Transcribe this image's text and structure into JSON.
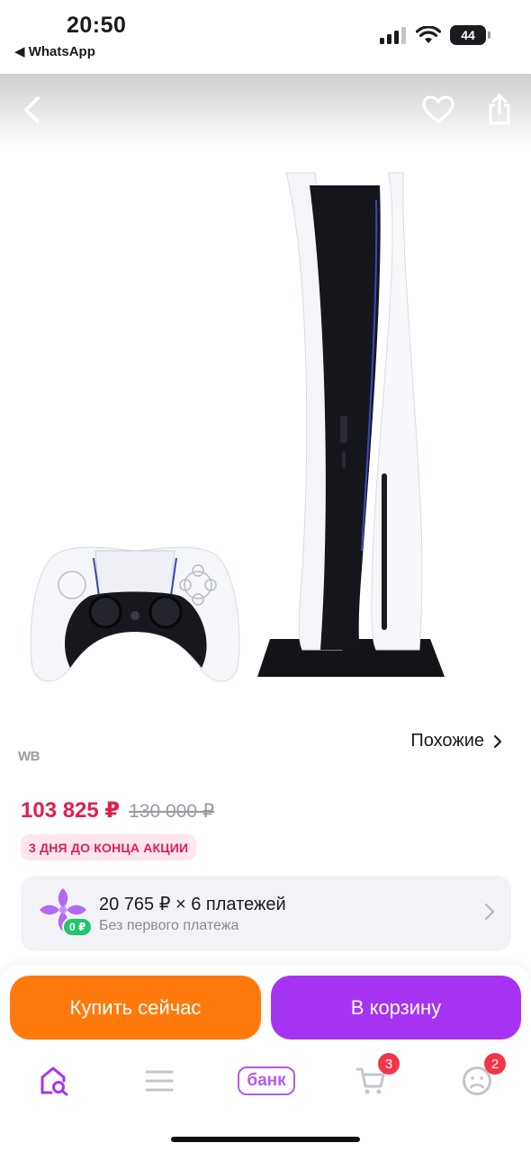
{
  "status_bar": {
    "time": "20:50",
    "back_app": "◀ WhatsApp",
    "battery": "44"
  },
  "header": {
    "back_icon": "chevron-left-icon",
    "favorite_icon": "heart-icon",
    "share_icon": "share-icon"
  },
  "product": {
    "image_subject": "console-and-controller",
    "similar_label": "Похожие",
    "brand_mark": "WB",
    "price_current": "103 825 ₽",
    "price_old": "130 000 ₽",
    "promo_badge": "3 ДНЯ ДО КОНЦА АКЦИИ",
    "installment": {
      "title": "20 765 ₽ × 6 платежей",
      "subtitle": "Без первого платежа",
      "badge": "0 ₽"
    }
  },
  "actions": {
    "buy_now": "Купить сейчас",
    "add_to_cart": "В корзину"
  },
  "bottom_nav": {
    "items": [
      {
        "icon": "home-search-icon",
        "active": true
      },
      {
        "icon": "menu-icon"
      },
      {
        "label": "банк"
      },
      {
        "icon": "cart-icon",
        "badge": "3"
      },
      {
        "icon": "profile-icon",
        "badge": "2"
      }
    ]
  },
  "colors": {
    "price_red": "#e01f50",
    "buy_orange": "#ff7a0d",
    "cart_purple": "#a733f2",
    "accent_purple": "#b35af0",
    "badge_red": "#f2364a",
    "installment_green": "#1fc66a"
  }
}
